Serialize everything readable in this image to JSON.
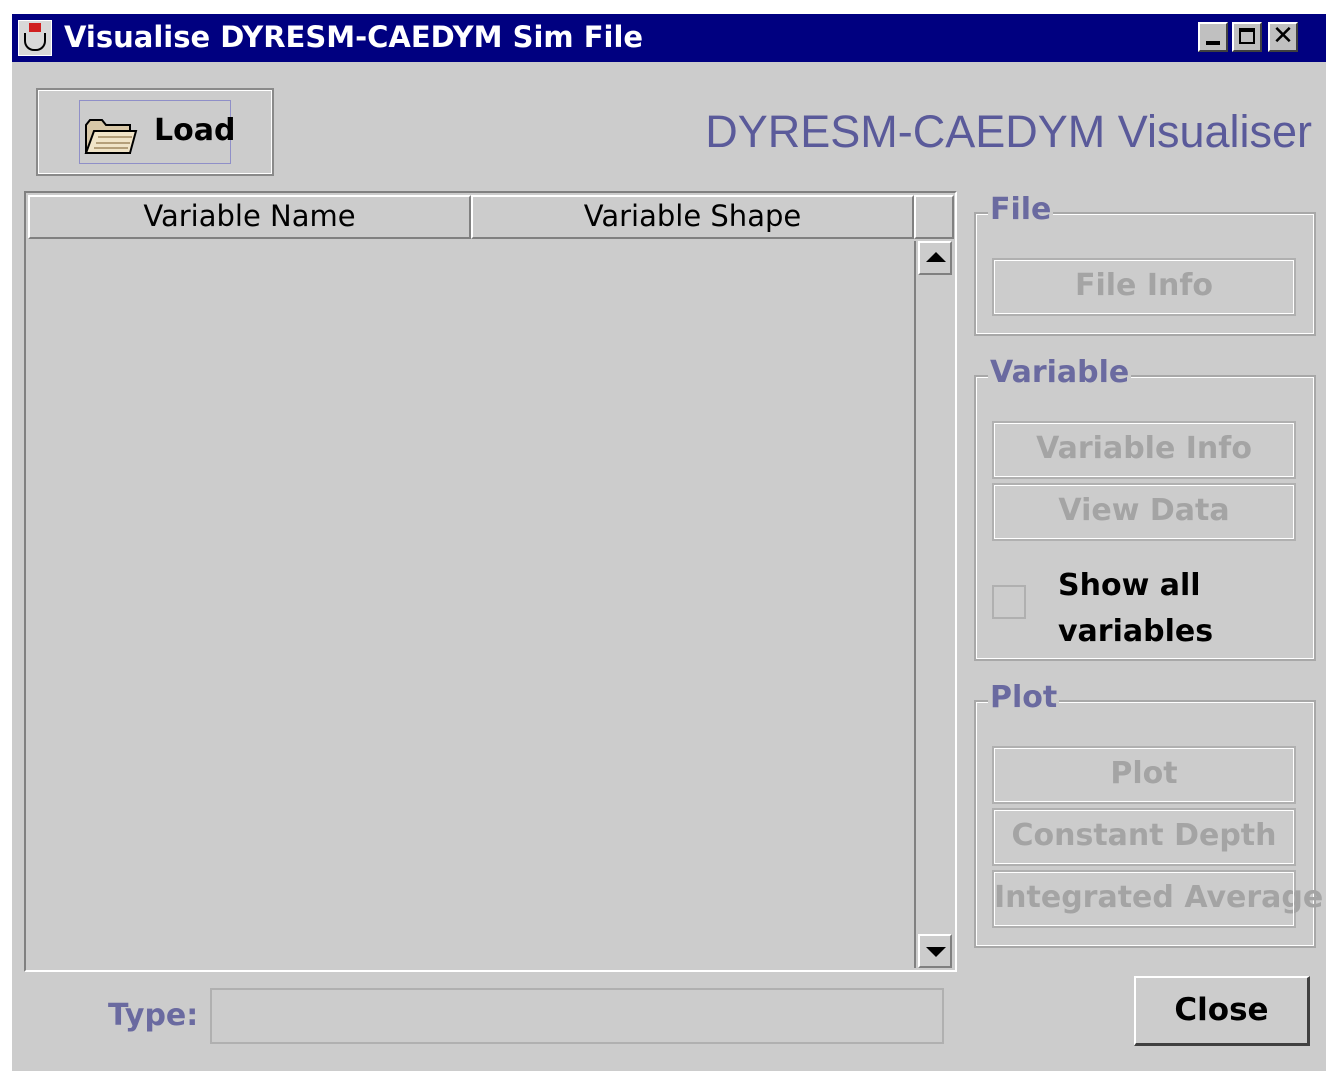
{
  "window": {
    "title": "Visualise DYRESM-CAEDYM Sim File",
    "controls": {
      "minimize_icon": "minimize-icon",
      "maximize_icon": "maximize-icon",
      "close_glyph": "✕"
    }
  },
  "toolbar": {
    "load_label": "Load",
    "load_icon": "folder-open-icon"
  },
  "app_title": "DYRESM-CAEDYM Visualiser",
  "table": {
    "columns": [
      "Variable Name",
      "Variable Shape"
    ],
    "rows": []
  },
  "groups": {
    "file": {
      "title": "File",
      "buttons": [
        "File Info"
      ]
    },
    "variable": {
      "title": "Variable",
      "buttons": [
        "Variable Info",
        "View Data"
      ],
      "show_all_line1": "Show all",
      "show_all_line2": "variables",
      "show_all_checked": false
    },
    "plot": {
      "title": "Plot",
      "buttons": [
        "Plot",
        "Constant Depth",
        "Integrated Average"
      ]
    }
  },
  "type": {
    "label": "Type:",
    "value": ""
  },
  "close_label": "Close",
  "colors": {
    "title_bar": "#000080",
    "panel_bg": "#cccccc",
    "accent_text": "#6a6aa0",
    "disabled_text": "#a4a4a4"
  }
}
